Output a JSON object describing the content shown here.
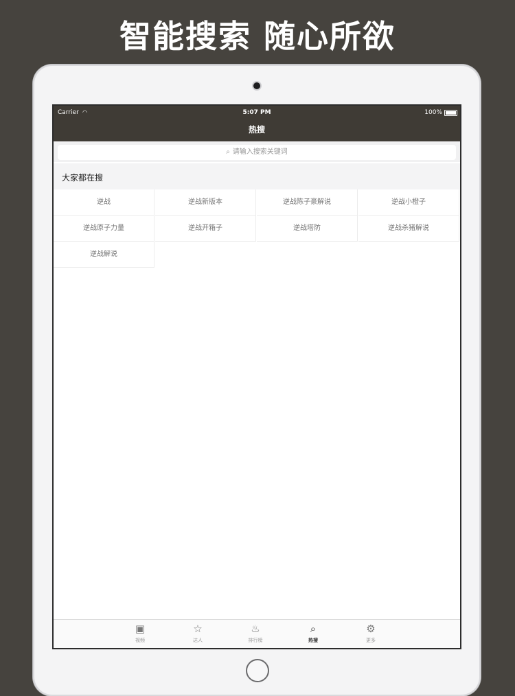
{
  "headline": "智能搜索 随心所欲",
  "status_bar": {
    "carrier": "Carrier",
    "time": "5:07 PM",
    "battery": "100%"
  },
  "nav": {
    "title": "热搜"
  },
  "search": {
    "placeholder": "请输入搜索关键词"
  },
  "section": {
    "title": "大家都在搜"
  },
  "hot_keywords": [
    "逆战",
    "逆战新版本",
    "逆战陈子豪解说",
    "逆战小橙子",
    "逆战原子力量",
    "逆战开箱子",
    "逆战塔防",
    "逆战杀猪解说",
    "逆战解说"
  ],
  "tabbar": {
    "items": [
      {
        "label": "视频",
        "icon": "video-icon"
      },
      {
        "label": "达人",
        "icon": "star-icon"
      },
      {
        "label": "排行榜",
        "icon": "flame-icon"
      },
      {
        "label": "热搜",
        "icon": "search-icon",
        "active": true
      },
      {
        "label": "更多",
        "icon": "gear-icon"
      }
    ]
  }
}
